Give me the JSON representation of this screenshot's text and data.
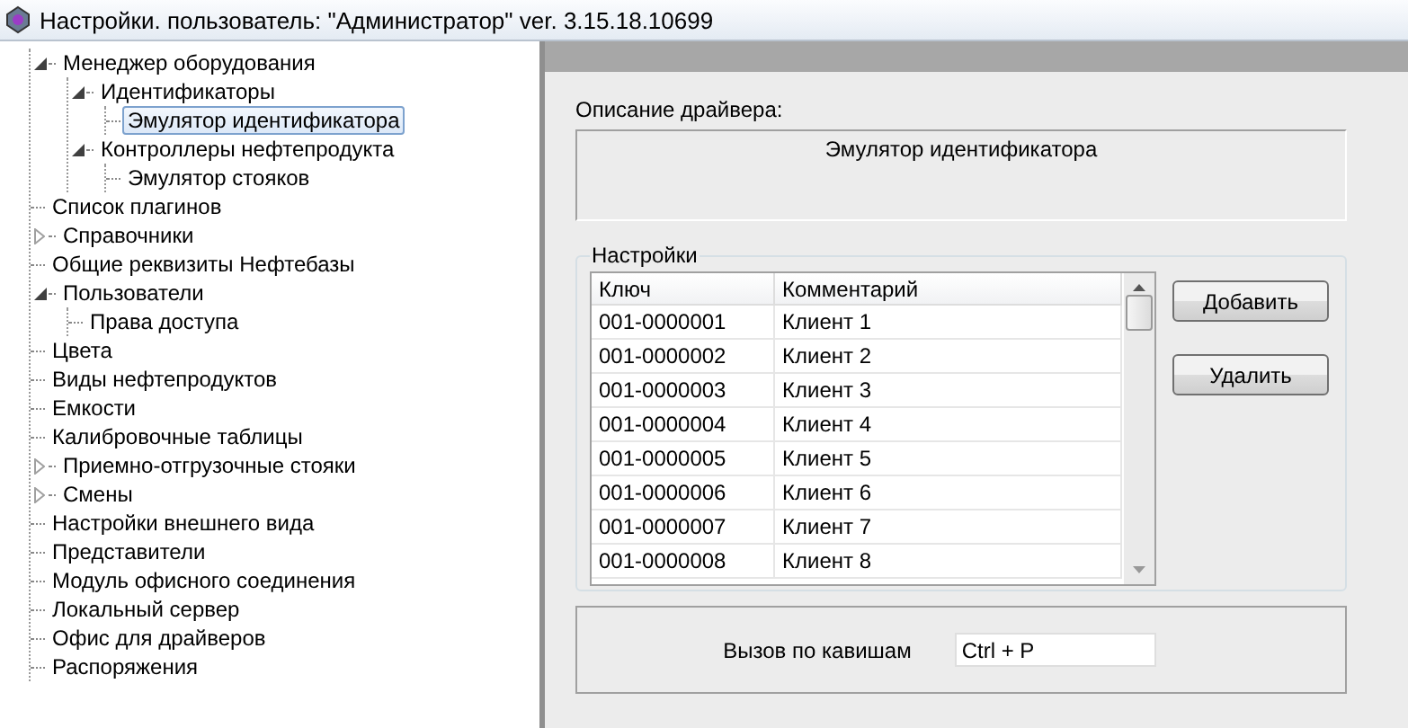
{
  "window": {
    "title": "Настройки. пользователь: \"Администратор\" ver. 3.15.18.10699"
  },
  "tree": [
    {
      "label": "Менеджер оборудования",
      "expanded": true,
      "selected": false,
      "children": [
        {
          "label": "Идентификаторы",
          "expanded": true,
          "selected": false,
          "children": [
            {
              "label": "Эмулятор идентификатора",
              "selected": true
            }
          ]
        },
        {
          "label": "Контроллеры нефтепродукта",
          "expanded": true,
          "selected": false,
          "children": [
            {
              "label": "Эмулятор стояков",
              "selected": false
            }
          ]
        }
      ]
    },
    {
      "label": "Список плагинов",
      "selected": false
    },
    {
      "label": "Справочники",
      "expanded": false,
      "selected": false
    },
    {
      "label": "Общие реквизиты Нефтебазы",
      "selected": false
    },
    {
      "label": "Пользователи",
      "expanded": true,
      "selected": false,
      "children": [
        {
          "label": "Права доступа",
          "selected": false
        }
      ]
    },
    {
      "label": "Цвета",
      "selected": false
    },
    {
      "label": "Виды нефтепродуктов",
      "selected": false
    },
    {
      "label": "Емкости",
      "selected": false
    },
    {
      "label": "Калибровочные таблицы",
      "selected": false
    },
    {
      "label": "Приемно-отгрузочные стояки",
      "expanded": false,
      "selected": false
    },
    {
      "label": "Смены",
      "expanded": false,
      "selected": false
    },
    {
      "label": "Настройки внешнего вида",
      "selected": false
    },
    {
      "label": "Представители",
      "selected": false
    },
    {
      "label": "Модуль офисного соединения",
      "selected": false
    },
    {
      "label": "Локальный сервер",
      "selected": false
    },
    {
      "label": "Офис для драйверов",
      "selected": false
    },
    {
      "label": "Распоряжения",
      "selected": false
    }
  ],
  "driver_description": {
    "label": "Описание драйвера:",
    "value": "Эмулятор идентификатора"
  },
  "settings": {
    "title": "Настройки",
    "columns": [
      "Ключ",
      "Комментарий"
    ],
    "rows": [
      [
        "001-0000001",
        "Клиент 1"
      ],
      [
        "001-0000002",
        "Клиент 2"
      ],
      [
        "001-0000003",
        "Клиент 3"
      ],
      [
        "001-0000004",
        "Клиент 4"
      ],
      [
        "001-0000005",
        "Клиент 5"
      ],
      [
        "001-0000006",
        "Клиент 6"
      ],
      [
        "001-0000007",
        "Клиент 7"
      ],
      [
        "001-0000008",
        "Клиент 8"
      ]
    ],
    "buttons": [
      "Добавить",
      "Удалить"
    ]
  },
  "hotkey": {
    "label": "Вызов по кавишам",
    "value": "Ctrl + P"
  }
}
